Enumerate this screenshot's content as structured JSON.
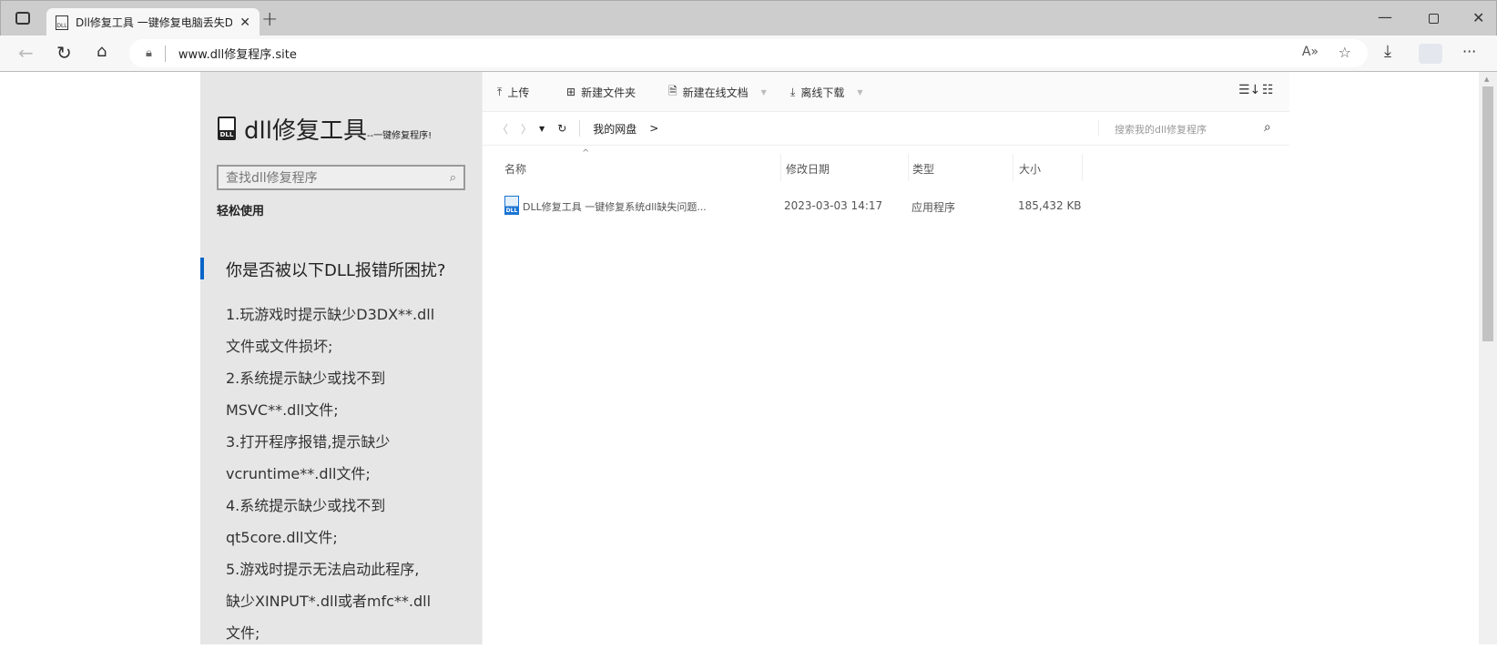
{
  "browser": {
    "tab_title": "Dll修复工具 一键修复电脑丢失DLL",
    "url": "www.dll修复程序.site"
  },
  "sidebar": {
    "title": "dll修复工具",
    "subtitle": "--一键修复程序!",
    "search_placeholder": "查找dll修复程序",
    "section": "轻松使用",
    "heading": "你是否被以下DLL报错所困扰?",
    "lines": [
      "1.玩游戏时提示缺少D3DX**.dll",
      "文件或文件损坏;",
      "2.系统提示缺少或找不到",
      "MSVC**.dll文件;",
      "3.打开程序报错,提示缺少",
      "vcruntime**.dll文件;",
      "4.系统提示缺少或找不到",
      "qt5core.dll文件;",
      "5.游戏时提示无法启动此程序,",
      "缺少XINPUT*.dll或者mfc**.dll",
      "文件;"
    ]
  },
  "toolbar": {
    "upload": "上传",
    "new_folder": "新建文件夹",
    "new_doc": "新建在线文档",
    "offline_download": "离线下载"
  },
  "nav": {
    "breadcrumb": "我的网盘",
    "breadcrumb_sep": ">",
    "search_placeholder": "搜索我的dll修复程序"
  },
  "table": {
    "headers": [
      "名称",
      "修改日期",
      "类型",
      "大小"
    ],
    "rows": [
      {
        "name": "DLL修复工具 一键修复系统dll缺失问题...",
        "date": "2023-03-03 14:17",
        "type": "应用程序",
        "size": "185,432 KB"
      }
    ]
  },
  "colors": {
    "accent": "#0a64c8",
    "sidebar_bg": "#e6e6e6"
  }
}
